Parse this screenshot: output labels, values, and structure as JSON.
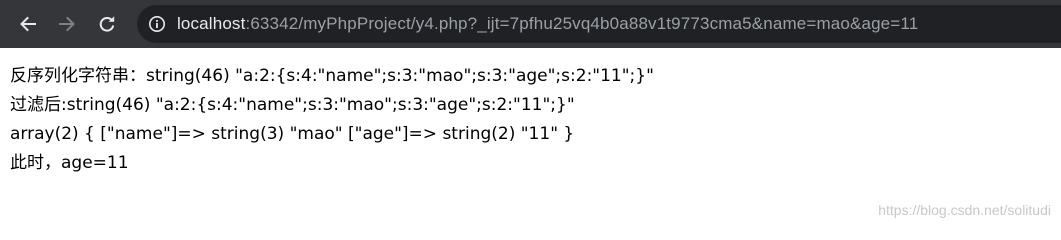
{
  "browser": {
    "url_host": "localhost",
    "url_rest": ":63342/myPhpProject/y4.php?_ijt=7pfhu25vq4b0a88v1t9773cma5&name=mao&age=11",
    "toolbar_color": "#35363a",
    "omnibox_color": "#202124",
    "icons": {
      "back": "arrow-left-icon",
      "forward": "arrow-right-icon",
      "reload": "reload-icon",
      "site_info": "info-icon"
    }
  },
  "page": {
    "lines": [
      "反序列化字符串：string(46) \"a:2:{s:4:\"name\";s:3:\"mao\";s:3:\"age\";s:2:\"11\";}\"",
      "过滤后:string(46) \"a:2:{s:4:\"name\";s:3:\"mao\";s:3:\"age\";s:2:\"11\";}\"",
      "array(2) { [\"name\"]=> string(3) \"mao\" [\"age\"]=> string(2) \"11\" }",
      "此时，age=11"
    ]
  },
  "watermark": "https://blog.csdn.net/solitudi"
}
